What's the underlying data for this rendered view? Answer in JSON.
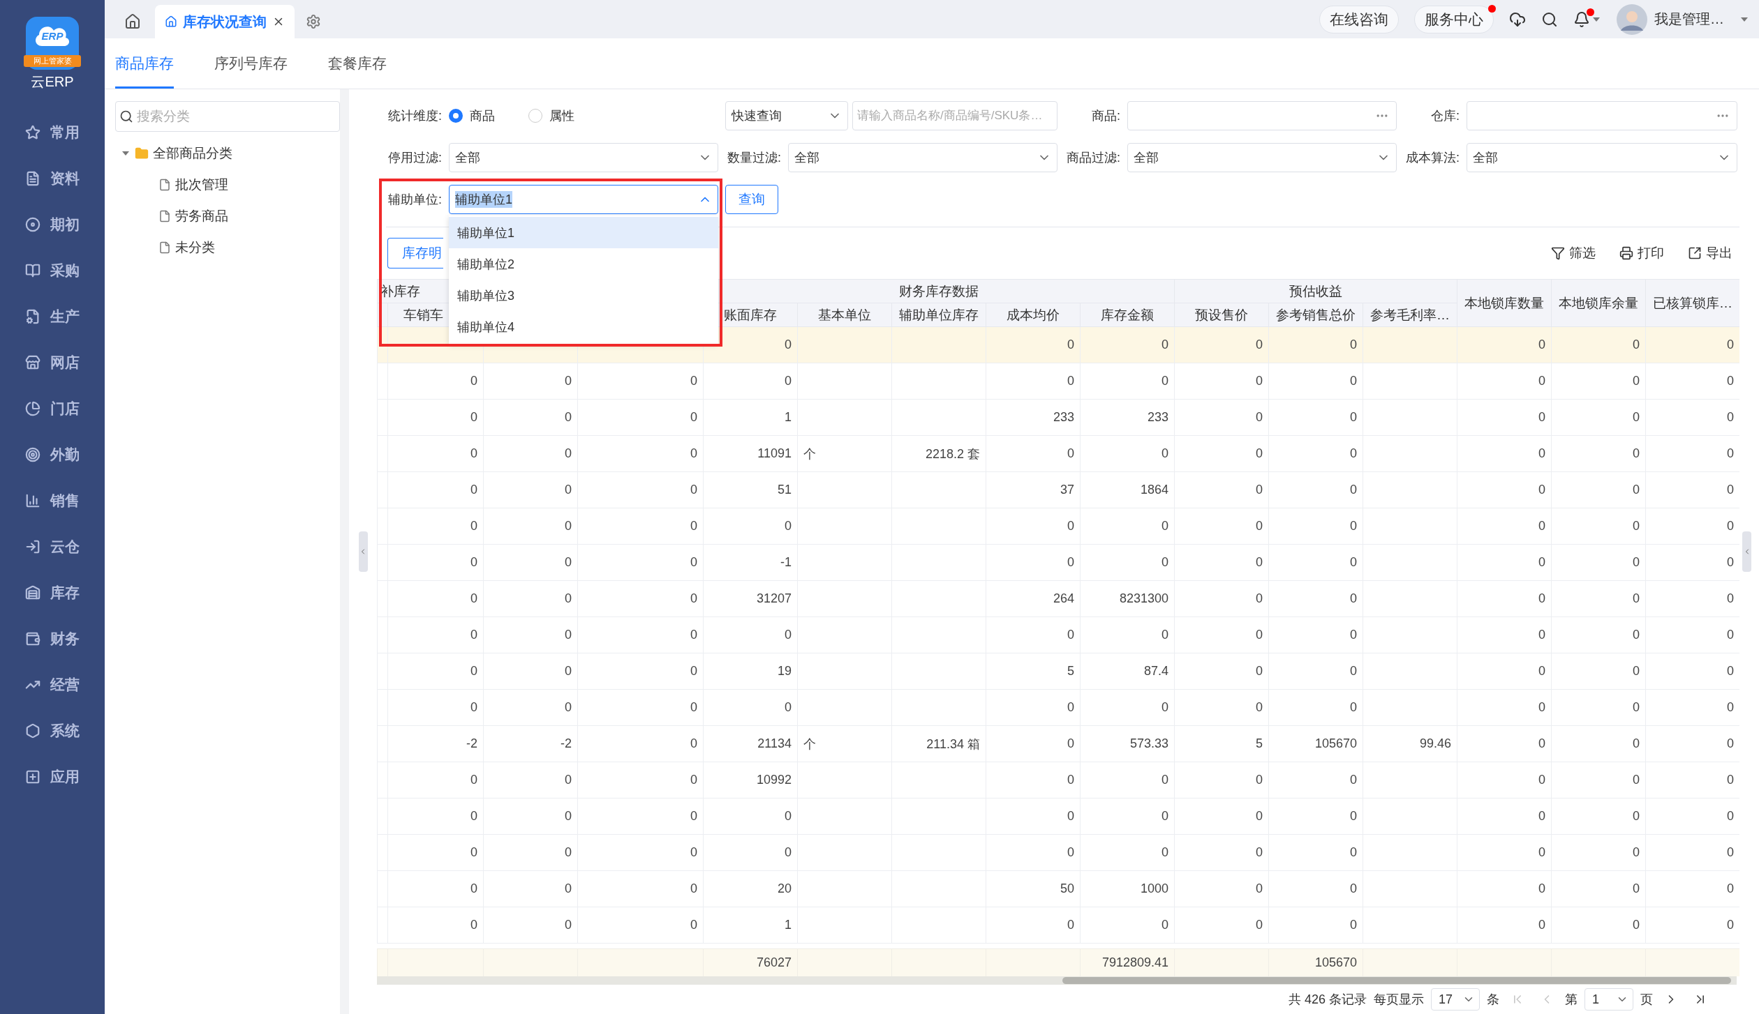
{
  "sidebar": {
    "logo": {
      "mark": "ERP",
      "badge": "网上管家婆",
      "name": "云ERP"
    },
    "items": [
      {
        "label": "常用"
      },
      {
        "label": "资料"
      },
      {
        "label": "期初"
      },
      {
        "label": "采购"
      },
      {
        "label": "生产"
      },
      {
        "label": "网店"
      },
      {
        "label": "门店"
      },
      {
        "label": "外勤"
      },
      {
        "label": "销售"
      },
      {
        "label": "云仓"
      },
      {
        "label": "库存"
      },
      {
        "label": "财务"
      },
      {
        "label": "经营"
      },
      {
        "label": "系统"
      },
      {
        "label": "应用"
      }
    ]
  },
  "top_bar": {
    "tabs": [
      {
        "label": "库存状况查询",
        "selected": true
      }
    ],
    "links": [
      {
        "label": "在线咨询",
        "dot": false
      },
      {
        "label": "服务中心",
        "dot": true
      }
    ],
    "notifications": {
      "dot": true
    },
    "user": {
      "name": "我是管理…"
    }
  },
  "sub_tabs": [
    {
      "label": "商品库存",
      "selected": true
    },
    {
      "label": "序列号库存",
      "selected": false
    },
    {
      "label": "套餐库存",
      "selected": false
    }
  ],
  "category_tree": {
    "search_placeholder": "搜索分类",
    "items": [
      {
        "label": "全部商品分类",
        "expanded": true,
        "children": [
          {
            "label": "批次管理"
          },
          {
            "label": "劳务商品"
          },
          {
            "label": "未分类"
          }
        ]
      }
    ]
  },
  "filters": {
    "dimension": {
      "label": "统计维度:",
      "options": [
        {
          "label": "商品",
          "selected": true
        },
        {
          "label": "属性",
          "selected": false
        }
      ]
    },
    "quick_query": {
      "value": "快速查询",
      "placeholder": "请输入商品名称/商品编号/SKU条…"
    },
    "pickers": [
      {
        "label": "商品:"
      },
      {
        "label": "仓库:"
      }
    ],
    "selects": [
      {
        "label": "停用过滤:",
        "value": "全部"
      },
      {
        "label": "数量过滤:",
        "value": "全部"
      },
      {
        "label": "商品过滤:",
        "value": "全部"
      },
      {
        "label": "成本算法:",
        "value": "全部"
      }
    ],
    "aux_unit": {
      "label": "辅助单位:",
      "value": "辅助单位1",
      "expanded": true,
      "options": [
        {
          "label": "辅助单位1",
          "selected": true
        },
        {
          "label": "辅助单位2",
          "selected": false
        },
        {
          "label": "辅助单位3",
          "selected": false
        },
        {
          "label": "辅助单位4",
          "selected": false
        }
      ]
    },
    "query_button": "查询"
  },
  "toolbar": {
    "detail_button": "库存明",
    "actions": [
      {
        "label": "筛选"
      },
      {
        "label": "打印"
      },
      {
        "label": "导出"
      }
    ]
  },
  "table": {
    "header": [
      {
        "kind": "group",
        "label": "补库存",
        "columns": [
          {
            "kind": "label",
            "label": "车销车"
          },
          {
            "kind": "hidden"
          },
          {
            "kind": "hidden"
          }
        ]
      },
      {
        "kind": "group",
        "label": "财务库存数据",
        "columns": [
          {
            "kind": "label",
            "label": "账面库存",
            "total": "76027"
          },
          {
            "kind": "label",
            "label": "基本单位"
          },
          {
            "kind": "label",
            "label": "辅助单位库存"
          },
          {
            "kind": "label",
            "label": "成本均价"
          },
          {
            "kind": "label",
            "label": "库存金额",
            "total": "7912809.41"
          }
        ]
      },
      {
        "kind": "group",
        "label": "预估收益",
        "columns": [
          {
            "kind": "label",
            "label": "预设售价"
          },
          {
            "kind": "label",
            "label": "参考销售总价",
            "total": "105670"
          },
          {
            "kind": "label",
            "label": "参考毛利率…"
          }
        ]
      },
      {
        "kind": "single",
        "label": "本地锁库数量"
      },
      {
        "kind": "single",
        "label": "本地锁库余量"
      },
      {
        "kind": "single",
        "label": "已核算锁库…"
      }
    ],
    "rows": [
      {
        "selected": true,
        "cells": [
          null,
          null,
          null,
          "0",
          null,
          null,
          "0",
          "0",
          "0",
          "0",
          null,
          "0",
          "0",
          "0"
        ]
      },
      {
        "selected": false,
        "cells": [
          "0",
          "0",
          "0",
          "0",
          null,
          null,
          "0",
          "0",
          "0",
          "0",
          null,
          "0",
          "0",
          "0"
        ]
      },
      {
        "selected": false,
        "cells": [
          "0",
          "0",
          "0",
          "1",
          null,
          null,
          "233",
          "233",
          "0",
          "0",
          null,
          "0",
          "0",
          "0"
        ]
      },
      {
        "selected": false,
        "cells": [
          "0",
          "0",
          "0",
          "11091",
          "个",
          "2218.2 套",
          "0",
          "0",
          "0",
          "0",
          null,
          "0",
          "0",
          "0"
        ]
      },
      {
        "selected": false,
        "cells": [
          "0",
          "0",
          "0",
          "51",
          null,
          null,
          "37",
          "1864",
          "0",
          "0",
          null,
          "0",
          "0",
          "0"
        ]
      },
      {
        "selected": false,
        "cells": [
          "0",
          "0",
          "0",
          "0",
          null,
          null,
          "0",
          "0",
          "0",
          "0",
          null,
          "0",
          "0",
          "0"
        ]
      },
      {
        "selected": false,
        "cells": [
          "0",
          "0",
          "0",
          "-1",
          null,
          null,
          "0",
          "0",
          "0",
          "0",
          null,
          "0",
          "0",
          "0"
        ]
      },
      {
        "selected": false,
        "cells": [
          "0",
          "0",
          "0",
          "31207",
          null,
          null,
          "264",
          "8231300",
          "0",
          "0",
          null,
          "0",
          "0",
          "0"
        ]
      },
      {
        "selected": false,
        "cells": [
          "0",
          "0",
          "0",
          "0",
          null,
          null,
          "0",
          "0",
          "0",
          "0",
          null,
          "0",
          "0",
          "0"
        ]
      },
      {
        "selected": false,
        "cells": [
          "0",
          "0",
          "0",
          "19",
          null,
          null,
          "5",
          "87.4",
          "0",
          "0",
          null,
          "0",
          "0",
          "0"
        ]
      },
      {
        "selected": false,
        "cells": [
          "0",
          "0",
          "0",
          "0",
          null,
          null,
          "0",
          "0",
          "0",
          "0",
          null,
          "0",
          "0",
          "0"
        ]
      },
      {
        "selected": false,
        "cells": [
          "-2",
          "-2",
          "0",
          "21134",
          "个",
          "211.34 箱",
          "0",
          "573.33",
          "5",
          "105670",
          "99.46",
          "0",
          "0",
          "0"
        ]
      },
      {
        "selected": false,
        "cells": [
          "0",
          "0",
          "0",
          "10992",
          null,
          null,
          "0",
          "0",
          "0",
          "0",
          null,
          "0",
          "0",
          "0"
        ]
      },
      {
        "selected": false,
        "cells": [
          "0",
          "0",
          "0",
          "0",
          null,
          null,
          "0",
          "0",
          "0",
          "0",
          null,
          "0",
          "0",
          "0"
        ]
      },
      {
        "selected": false,
        "cells": [
          "0",
          "0",
          "0",
          "0",
          null,
          null,
          "0",
          "0",
          "0",
          "0",
          null,
          "0",
          "0",
          "0"
        ]
      },
      {
        "selected": false,
        "cells": [
          "0",
          "0",
          "0",
          "20",
          null,
          null,
          "50",
          "1000",
          "0",
          "0",
          null,
          "0",
          "0",
          "0"
        ]
      },
      {
        "selected": false,
        "cells": [
          "0",
          "0",
          "0",
          "1",
          null,
          null,
          "0",
          "0",
          "0",
          "0",
          null,
          "0",
          "0",
          "0"
        ]
      }
    ]
  },
  "pagination": {
    "total": "共 426 条记录",
    "page_size_label": "每页显示",
    "page_size": "17",
    "page_size_unit": "条",
    "page_prefix": "第",
    "page": "1",
    "page_suffix": "页",
    "nav": [
      {
        "kind": "first",
        "disabled": true
      },
      {
        "kind": "prev",
        "disabled": true
      },
      {
        "kind": "next",
        "disabled": false
      },
      {
        "kind": "last",
        "disabled": false
      }
    ]
  }
}
